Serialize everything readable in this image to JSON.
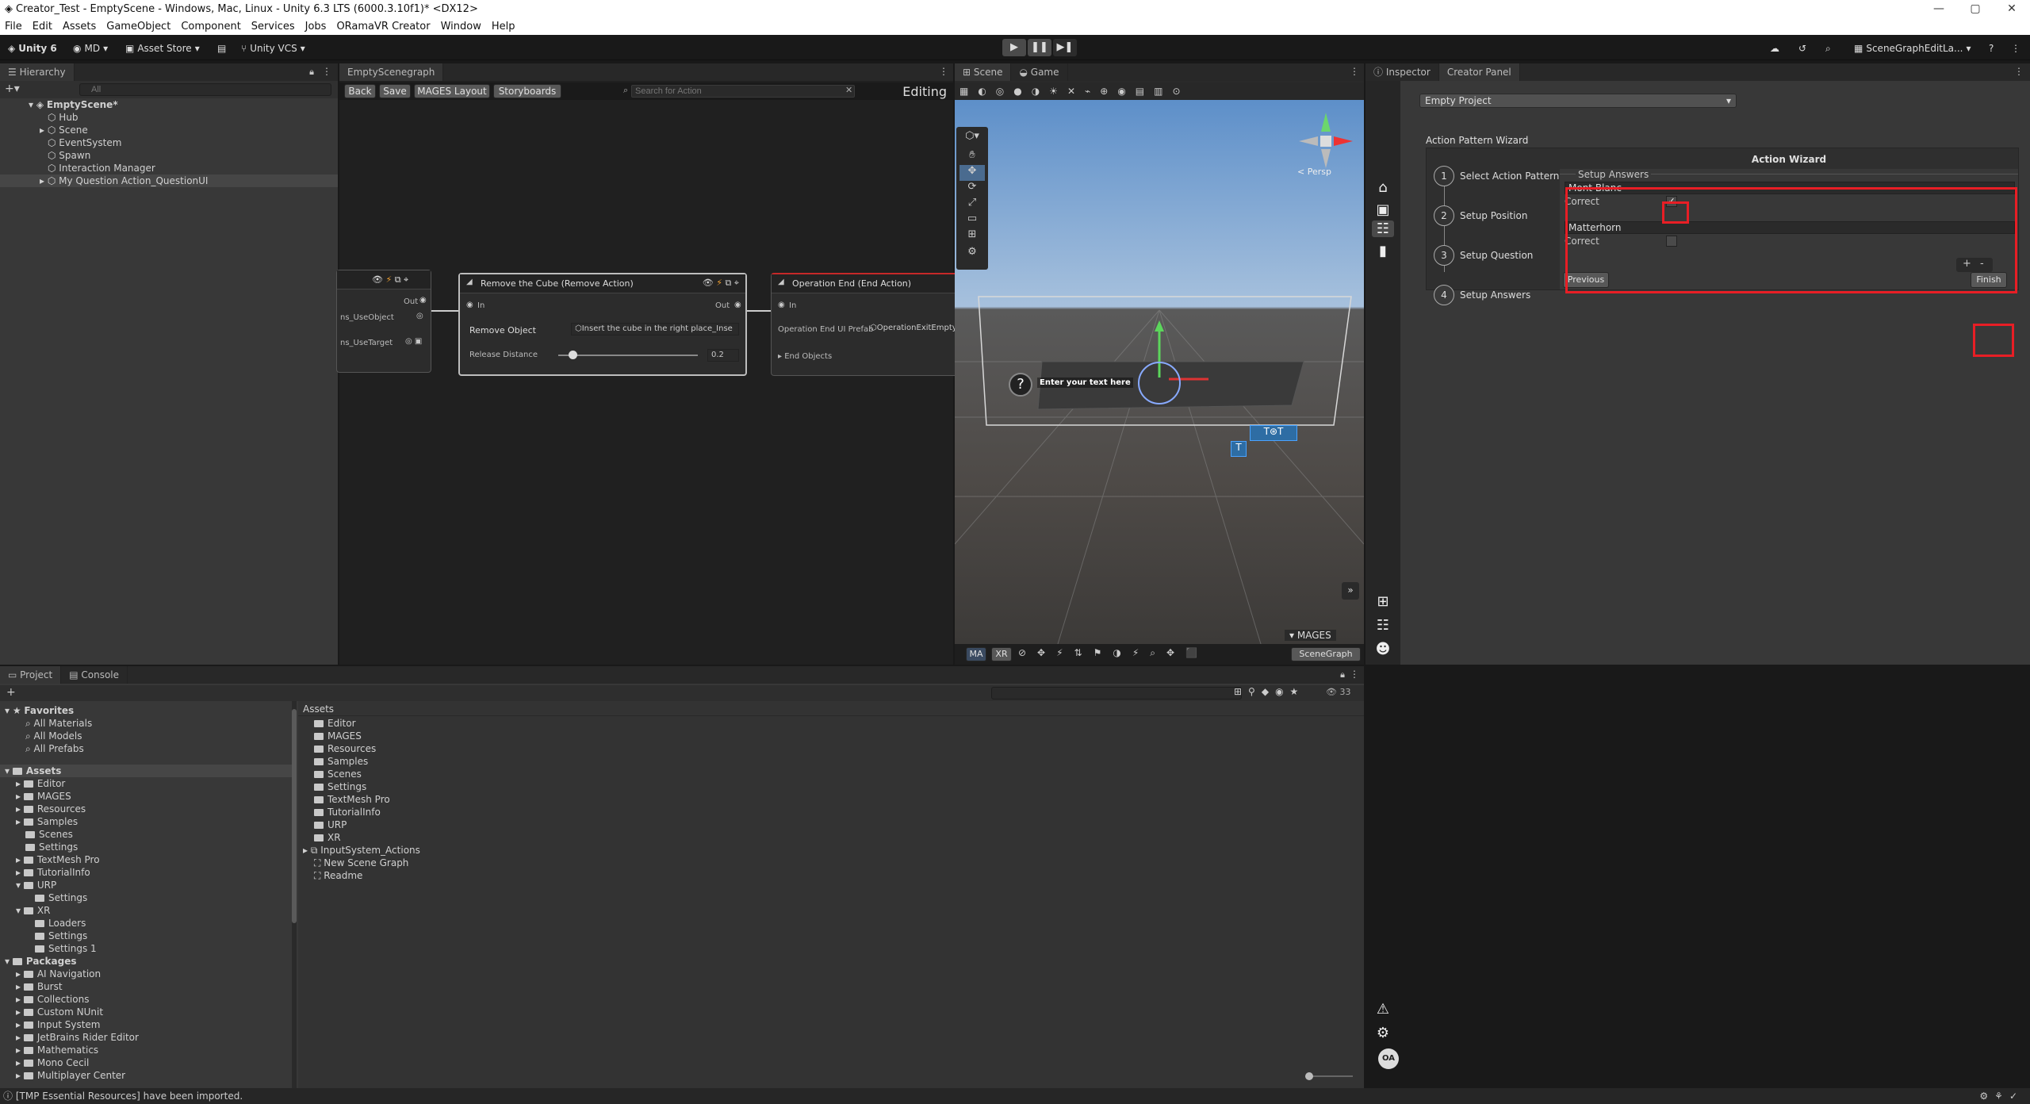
{
  "window": {
    "title": "Creator_Test - EmptyScene - Windows, Mac, Linux - Unity 6.3 LTS (6000.3.10f1)* <DX12>"
  },
  "menu": [
    "File",
    "Edit",
    "Assets",
    "GameObject",
    "Component",
    "Services",
    "Jobs",
    "ORamaVR Creator",
    "Window",
    "Help"
  ],
  "toolbar": {
    "unity": "Unity 6",
    "account": "MD",
    "asset_store": "Asset Store",
    "vcs": "Unity VCS",
    "layout": "SceneGraphEditLa..."
  },
  "hierarchy": {
    "tab": "Hierarchy",
    "search_placeholder": "All",
    "scene": "EmptyScene*",
    "items": [
      "Hub",
      "Scene",
      "EventSystem",
      "Spawn",
      "Interaction Manager",
      "My Question Action_QuestionUI"
    ]
  },
  "graph": {
    "tab": "EmptyScenegraph",
    "buttons": [
      "Back",
      "Save",
      "MAGES Layout",
      "Storyboards"
    ],
    "search_placeholder": "Search for Action",
    "mode": "Editing",
    "node_left": {
      "out": "Out",
      "field1": "ns_UseObject",
      "field2": "ns_UseTarget"
    },
    "node_remove": {
      "title": "Remove the Cube (Remove Action)",
      "in": "In",
      "out": "Out",
      "remove_label": "Remove Object",
      "remove_value": "Insert the cube in the right place_Inse",
      "release_label": "Release Distance",
      "release_value": "0.2",
      "release_fraction": 0.05
    },
    "node_end": {
      "title": "Operation End (End Action)",
      "in": "In",
      "prefab_label": "Operation End UI Prefab",
      "prefab_value": "OperationExitEmpty",
      "end_objects": "End Objects"
    }
  },
  "scene": {
    "tabs": [
      "Scene",
      "Game"
    ],
    "persp": "< Persp",
    "billboard": "Enter your text here",
    "mages": "MAGES",
    "bottom_tools": [
      "MA",
      "XR"
    ],
    "scenegraph_btn": "SceneGraph"
  },
  "inspector": {
    "tabs": [
      "Inspector",
      "Creator Panel"
    ],
    "project_select": "Empty Project",
    "wizard_heading": "Action Pattern Wizard",
    "wizard_title": "Action Wizard",
    "steps": [
      {
        "num": "1",
        "label": "Select Action Pattern"
      },
      {
        "num": "2",
        "label": "Setup Position"
      },
      {
        "num": "3",
        "label": "Setup Question"
      },
      {
        "num": "4",
        "label": "Setup Answers"
      }
    ],
    "answers_heading": "Setup Answers",
    "answers": [
      {
        "text": "Mont Blanc",
        "correct_label": "Correct",
        "correct": true
      },
      {
        "text": "Matterhorn",
        "correct_label": "Correct",
        "correct": false
      }
    ],
    "add": "+",
    "remove": "-",
    "previous": "Previous",
    "finish": "Finish",
    "avatar": "OA"
  },
  "project": {
    "tabs": [
      "Project",
      "Console"
    ],
    "favorites": "Favorites",
    "fav_items": [
      "All Materials",
      "All Models",
      "All Prefabs"
    ],
    "assets_root": "Assets",
    "tree_assets": [
      "Editor",
      "MAGES",
      "Resources",
      "Samples",
      "Scenes",
      "Settings",
      "TextMesh Pro",
      "TutorialInfo",
      "URP",
      "Settings",
      "XR",
      "Loaders",
      "Settings",
      "Settings 1"
    ],
    "packages": "Packages",
    "tree_packages": [
      "AI Navigation",
      "Burst",
      "Collections",
      "Custom NUnit",
      "Input System",
      "JetBrains Rider Editor",
      "Mathematics",
      "Mono Cecil",
      "Multiplayer Center"
    ],
    "breadcrumb": "Assets",
    "grid_items": [
      "Editor",
      "MAGES",
      "Resources",
      "Samples",
      "Scenes",
      "Settings",
      "TextMesh Pro",
      "TutorialInfo",
      "URP",
      "XR",
      "InputSystem_Actions",
      "New Scene Graph",
      "Readme"
    ],
    "count": "33"
  },
  "status": {
    "message": "[TMP Essential Resources] have been imported."
  }
}
